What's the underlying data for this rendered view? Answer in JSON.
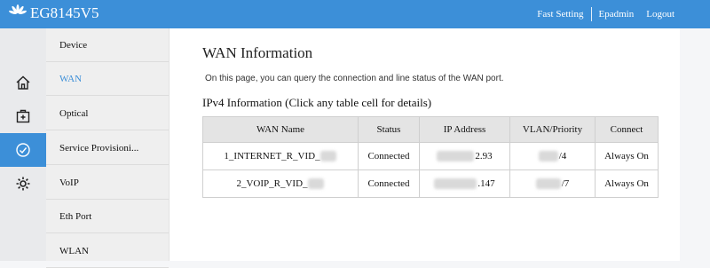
{
  "header": {
    "brand": "EG8145V5",
    "links": [
      "Fast Setting",
      "Epadmin",
      "Logout"
    ]
  },
  "sidebar": {
    "icons": [
      "home-icon",
      "medical-box-icon",
      "check-circle-icon",
      "gear-icon"
    ],
    "items": [
      "Device",
      "WAN",
      "Optical",
      "Service Provisioni...",
      "VoIP",
      "Eth Port",
      "WLAN"
    ]
  },
  "main": {
    "title": "WAN Information",
    "description": "On this page, you can query the connection and line status of the WAN port.",
    "subtitle": "IPv4 Information (Click any table cell for details)",
    "table": {
      "headers": [
        "WAN Name",
        "Status",
        "IP Address",
        "VLAN/Priority",
        "Connect"
      ],
      "rows": [
        [
          "1_INTERNET_R_VID_",
          "Connected",
          "2.93",
          "/4",
          "Always On"
        ],
        [
          "2_VOIP_R_VID_",
          "Connected",
          ".147",
          "/7",
          "Always On"
        ]
      ]
    }
  },
  "colors": {
    "accent": "#3c8fd8",
    "nav_bg": "#efefef",
    "table_header": "#e4e4e4"
  }
}
